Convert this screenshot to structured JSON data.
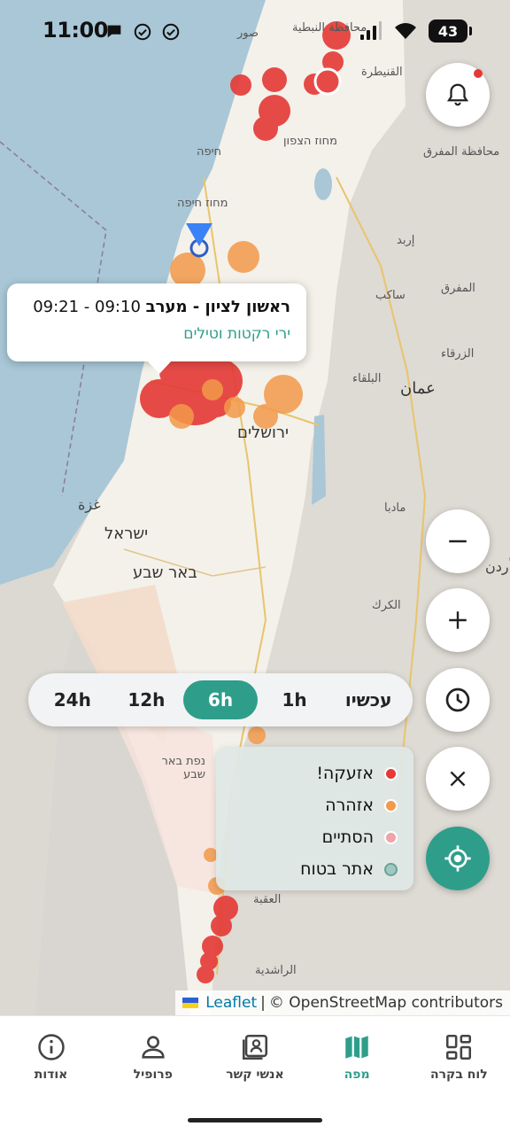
{
  "status_bar": {
    "time": "11:00",
    "battery": "43"
  },
  "map": {
    "labels": {
      "jerusalem": "ירושלים",
      "amman": "عمان",
      "israel": "ישראל",
      "beer_sheva": "באר שבע",
      "gaza": "غزة",
      "haifa": "חיפה",
      "haifa_district": "מחוז חיפה",
      "north_district": "מחוז הצפון",
      "mafraq": "المفرق",
      "zarqa": "الزرقاء",
      "balqa": "البلقاء",
      "madaba": "مادبا",
      "karak": "الكرك",
      "aqaba": "العقبة",
      "rashidiya": "الراشدية",
      "quneitra": "القنيطرة",
      "nabatieh": "محافظة النبطية",
      "tyre": "صور",
      "irbid": "إربد",
      "sakeb": "ساكب",
      "mafraq_gov": "محافظة المفرق",
      "jordan": "أردن",
      "beer_sheva_district": "נפת באר שבע"
    }
  },
  "popup": {
    "place": "ראשון לציון - מערב",
    "time_range": "09:10 - 09:21",
    "alert_type": "ירי רקטות וטילים"
  },
  "time_filter": {
    "options": [
      {
        "label": "24h",
        "active": false
      },
      {
        "label": "12h",
        "active": false
      },
      {
        "label": "6h",
        "active": true
      },
      {
        "label": "1h",
        "active": false
      },
      {
        "label": "עכשיו",
        "active": false
      }
    ]
  },
  "legend": {
    "items": [
      {
        "label": "אזעקה!",
        "color": "#e53935"
      },
      {
        "label": "אזהרה",
        "color": "#f29a4a"
      },
      {
        "label": "הסתיים",
        "color": "#f0a3a8"
      },
      {
        "label": "אתר בטוח",
        "color": "#9fc9c0"
      }
    ]
  },
  "attribution": {
    "leaflet": "Leaflet",
    "separator": "|",
    "osm": "© OpenStreetMap contributors"
  },
  "bottom_nav": {
    "items": [
      {
        "label": "אודות",
        "icon": "info-icon"
      },
      {
        "label": "פרופיל",
        "icon": "person-icon"
      },
      {
        "label": "אנשי קשר",
        "icon": "contacts-icon"
      },
      {
        "label": "מפה",
        "icon": "map-icon",
        "active": true
      },
      {
        "label": "לוח בקרה",
        "icon": "dashboard-icon"
      }
    ]
  },
  "colors": {
    "accent": "#2e9e8b",
    "alert": "#e53935",
    "warning": "#f29a4a",
    "ended": "#f0a3a8",
    "safe": "#9fc9c0"
  }
}
